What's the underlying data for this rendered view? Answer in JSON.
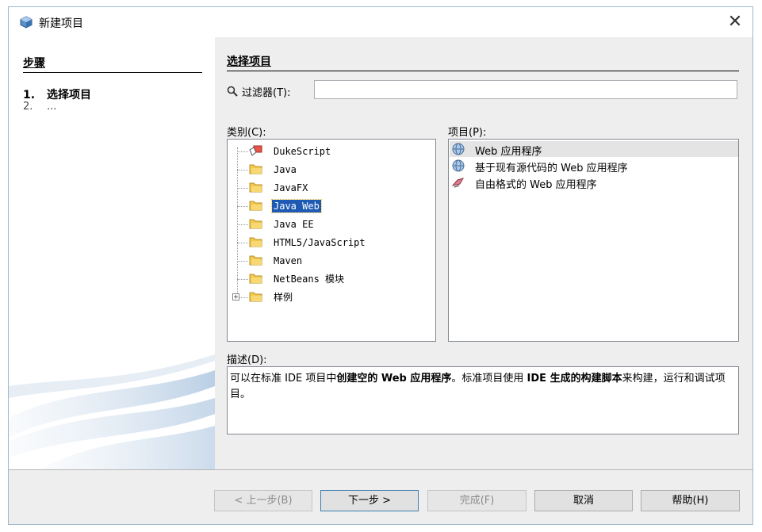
{
  "window": {
    "title": "新建项目",
    "close_glyph": "✕"
  },
  "steps": {
    "header": "步骤",
    "items": [
      {
        "num": "1.",
        "label": "选择项目"
      },
      {
        "num": "2.",
        "label": "..."
      }
    ]
  },
  "main": {
    "header": "选择项目",
    "filter_label": "过滤器(T):",
    "filter_value": "",
    "categories_label": "类别(C):",
    "projects_label": "项目(P):",
    "categories": [
      {
        "label": "DukeScript",
        "icon": "dukescript-icon"
      },
      {
        "label": "Java",
        "icon": "folder-icon"
      },
      {
        "label": "JavaFX",
        "icon": "folder-icon"
      },
      {
        "label": "Java Web",
        "icon": "folder-icon",
        "selected": true
      },
      {
        "label": "Java EE",
        "icon": "folder-icon"
      },
      {
        "label": "HTML5/JavaScript",
        "icon": "folder-icon"
      },
      {
        "label": "Maven",
        "icon": "folder-icon"
      },
      {
        "label": "NetBeans 模块",
        "icon": "folder-icon"
      },
      {
        "label": "样例",
        "icon": "folder-icon",
        "expander": "+"
      }
    ],
    "projects": [
      {
        "label": "Web 应用程序",
        "icon": "globe-icon",
        "selected": true
      },
      {
        "label": "基于现有源代码的 Web 应用程序",
        "icon": "globe-icon"
      },
      {
        "label": "自由格式的 Web 应用程序",
        "icon": "freeform-icon"
      }
    ],
    "description_label": "描述(D):",
    "description": {
      "p1": "可以在标准 IDE 项目中",
      "b1": "创建空的 Web 应用程序",
      "p2": "。标准项目使用 ",
      "b2": "IDE 生成的构建脚本",
      "p3": "来构建，运行和调试项目。"
    }
  },
  "buttons": {
    "back": "< 上一步(B)",
    "next": "下一步 >",
    "finish": "完成(F)",
    "cancel": "取消",
    "help": "帮助(H)"
  },
  "colors": {
    "selection": "#1e5ab4",
    "folder": "#f2c94c",
    "accent_border": "#3c7fb1"
  }
}
